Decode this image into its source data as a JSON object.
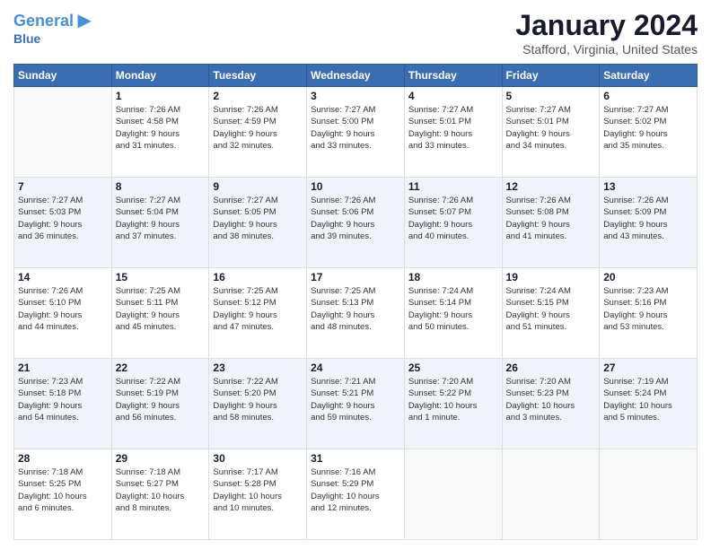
{
  "logo": {
    "text_general": "General",
    "text_blue": "Blue"
  },
  "header": {
    "month": "January 2024",
    "location": "Stafford, Virginia, United States"
  },
  "weekdays": [
    "Sunday",
    "Monday",
    "Tuesday",
    "Wednesday",
    "Thursday",
    "Friday",
    "Saturday"
  ],
  "weeks": [
    [
      {
        "day": "",
        "info": ""
      },
      {
        "day": "1",
        "info": "Sunrise: 7:26 AM\nSunset: 4:58 PM\nDaylight: 9 hours\nand 31 minutes."
      },
      {
        "day": "2",
        "info": "Sunrise: 7:26 AM\nSunset: 4:59 PM\nDaylight: 9 hours\nand 32 minutes."
      },
      {
        "day": "3",
        "info": "Sunrise: 7:27 AM\nSunset: 5:00 PM\nDaylight: 9 hours\nand 33 minutes."
      },
      {
        "day": "4",
        "info": "Sunrise: 7:27 AM\nSunset: 5:01 PM\nDaylight: 9 hours\nand 33 minutes."
      },
      {
        "day": "5",
        "info": "Sunrise: 7:27 AM\nSunset: 5:01 PM\nDaylight: 9 hours\nand 34 minutes."
      },
      {
        "day": "6",
        "info": "Sunrise: 7:27 AM\nSunset: 5:02 PM\nDaylight: 9 hours\nand 35 minutes."
      }
    ],
    [
      {
        "day": "7",
        "info": "Sunrise: 7:27 AM\nSunset: 5:03 PM\nDaylight: 9 hours\nand 36 minutes."
      },
      {
        "day": "8",
        "info": "Sunrise: 7:27 AM\nSunset: 5:04 PM\nDaylight: 9 hours\nand 37 minutes."
      },
      {
        "day": "9",
        "info": "Sunrise: 7:27 AM\nSunset: 5:05 PM\nDaylight: 9 hours\nand 38 minutes."
      },
      {
        "day": "10",
        "info": "Sunrise: 7:26 AM\nSunset: 5:06 PM\nDaylight: 9 hours\nand 39 minutes."
      },
      {
        "day": "11",
        "info": "Sunrise: 7:26 AM\nSunset: 5:07 PM\nDaylight: 9 hours\nand 40 minutes."
      },
      {
        "day": "12",
        "info": "Sunrise: 7:26 AM\nSunset: 5:08 PM\nDaylight: 9 hours\nand 41 minutes."
      },
      {
        "day": "13",
        "info": "Sunrise: 7:26 AM\nSunset: 5:09 PM\nDaylight: 9 hours\nand 43 minutes."
      }
    ],
    [
      {
        "day": "14",
        "info": "Sunrise: 7:26 AM\nSunset: 5:10 PM\nDaylight: 9 hours\nand 44 minutes."
      },
      {
        "day": "15",
        "info": "Sunrise: 7:25 AM\nSunset: 5:11 PM\nDaylight: 9 hours\nand 45 minutes."
      },
      {
        "day": "16",
        "info": "Sunrise: 7:25 AM\nSunset: 5:12 PM\nDaylight: 9 hours\nand 47 minutes."
      },
      {
        "day": "17",
        "info": "Sunrise: 7:25 AM\nSunset: 5:13 PM\nDaylight: 9 hours\nand 48 minutes."
      },
      {
        "day": "18",
        "info": "Sunrise: 7:24 AM\nSunset: 5:14 PM\nDaylight: 9 hours\nand 50 minutes."
      },
      {
        "day": "19",
        "info": "Sunrise: 7:24 AM\nSunset: 5:15 PM\nDaylight: 9 hours\nand 51 minutes."
      },
      {
        "day": "20",
        "info": "Sunrise: 7:23 AM\nSunset: 5:16 PM\nDaylight: 9 hours\nand 53 minutes."
      }
    ],
    [
      {
        "day": "21",
        "info": "Sunrise: 7:23 AM\nSunset: 5:18 PM\nDaylight: 9 hours\nand 54 minutes."
      },
      {
        "day": "22",
        "info": "Sunrise: 7:22 AM\nSunset: 5:19 PM\nDaylight: 9 hours\nand 56 minutes."
      },
      {
        "day": "23",
        "info": "Sunrise: 7:22 AM\nSunset: 5:20 PM\nDaylight: 9 hours\nand 58 minutes."
      },
      {
        "day": "24",
        "info": "Sunrise: 7:21 AM\nSunset: 5:21 PM\nDaylight: 9 hours\nand 59 minutes."
      },
      {
        "day": "25",
        "info": "Sunrise: 7:20 AM\nSunset: 5:22 PM\nDaylight: 10 hours\nand 1 minute."
      },
      {
        "day": "26",
        "info": "Sunrise: 7:20 AM\nSunset: 5:23 PM\nDaylight: 10 hours\nand 3 minutes."
      },
      {
        "day": "27",
        "info": "Sunrise: 7:19 AM\nSunset: 5:24 PM\nDaylight: 10 hours\nand 5 minutes."
      }
    ],
    [
      {
        "day": "28",
        "info": "Sunrise: 7:18 AM\nSunset: 5:25 PM\nDaylight: 10 hours\nand 6 minutes."
      },
      {
        "day": "29",
        "info": "Sunrise: 7:18 AM\nSunset: 5:27 PM\nDaylight: 10 hours\nand 8 minutes."
      },
      {
        "day": "30",
        "info": "Sunrise: 7:17 AM\nSunset: 5:28 PM\nDaylight: 10 hours\nand 10 minutes."
      },
      {
        "day": "31",
        "info": "Sunrise: 7:16 AM\nSunset: 5:29 PM\nDaylight: 10 hours\nand 12 minutes."
      },
      {
        "day": "",
        "info": ""
      },
      {
        "day": "",
        "info": ""
      },
      {
        "day": "",
        "info": ""
      }
    ]
  ]
}
